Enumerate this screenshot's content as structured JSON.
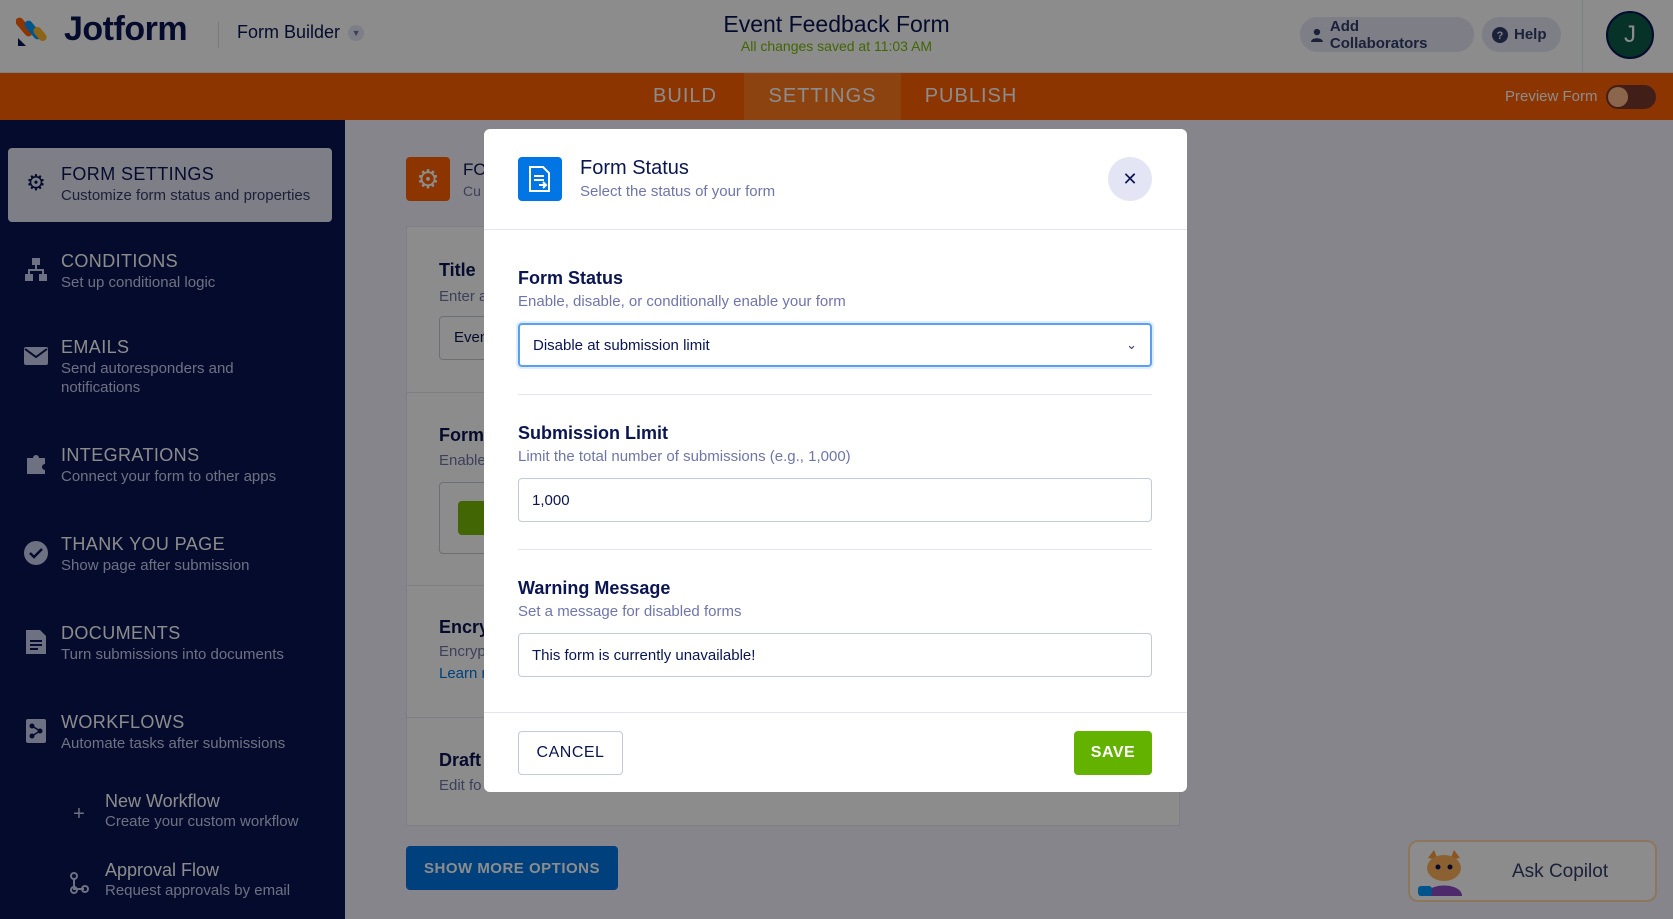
{
  "header": {
    "brand": "Jotform",
    "builder_menu": "Form Builder",
    "form_title": "Event Feedback Form",
    "save_status": "All changes saved at 11:03 AM",
    "add_collaborators": "Add Collaborators",
    "help": "Help",
    "avatar_initial": "J"
  },
  "nav": {
    "tabs": [
      {
        "label": "BUILD"
      },
      {
        "label": "SETTINGS"
      },
      {
        "label": "PUBLISH"
      }
    ],
    "active_tab": "SETTINGS",
    "preview_label": "Preview Form",
    "preview_enabled": false
  },
  "sidebar": {
    "items": [
      {
        "title": "FORM SETTINGS",
        "desc": "Customize form status and properties",
        "icon": "gear-icon"
      },
      {
        "title": "CONDITIONS",
        "desc": "Set up conditional logic",
        "icon": "conditions-icon"
      },
      {
        "title": "EMAILS",
        "desc": "Send autoresponders and notifications",
        "icon": "envelope-icon"
      },
      {
        "title": "INTEGRATIONS",
        "desc": "Connect your form to other apps",
        "icon": "puzzle-icon"
      },
      {
        "title": "THANK YOU PAGE",
        "desc": "Show page after submission",
        "icon": "check-circle-icon"
      },
      {
        "title": "DOCUMENTS",
        "desc": "Turn submissions into documents",
        "icon": "document-icon"
      },
      {
        "title": "WORKFLOWS",
        "desc": "Automate tasks after submissions",
        "icon": "workflow-icon"
      }
    ],
    "sub_items": [
      {
        "title": "New Workflow",
        "desc": "Create your custom workflow",
        "icon": "plus-icon"
      },
      {
        "title": "Approval Flow",
        "desc": "Request approvals by email",
        "icon": "approval-flow-icon"
      }
    ]
  },
  "main": {
    "head_title": "FO",
    "head_desc": "Cu",
    "title_label": "Title",
    "title_desc": "Enter a",
    "title_value": "Even",
    "form_label": "Form",
    "form_desc": "Enable",
    "encryption_label": "Encry",
    "encryption_desc": "Encryp",
    "learn_more": "Learn m",
    "draft_label": "Draft",
    "draft_desc": "Edit fo",
    "show_more": "SHOW MORE OPTIONS"
  },
  "modal": {
    "title": "Form Status",
    "subtitle": "Select the status of your form",
    "status_label": "Form Status",
    "status_desc": "Enable, disable, or conditionally enable your form",
    "status_value": "Disable at submission limit",
    "limit_label": "Submission Limit",
    "limit_desc": "Limit the total number of submissions (e.g., 1,000)",
    "limit_value": "1,000",
    "warning_label": "Warning Message",
    "warning_desc": "Set a message for disabled forms",
    "warning_value": "This form is currently unavailable!",
    "cancel": "CANCEL",
    "save": "SAVE"
  },
  "copilot": {
    "label": "Ask Copilot"
  },
  "colors": {
    "brand_orange": "#ff6100",
    "navy": "#0a1551",
    "save_green": "#64b200",
    "link_blue": "#0075e3"
  }
}
